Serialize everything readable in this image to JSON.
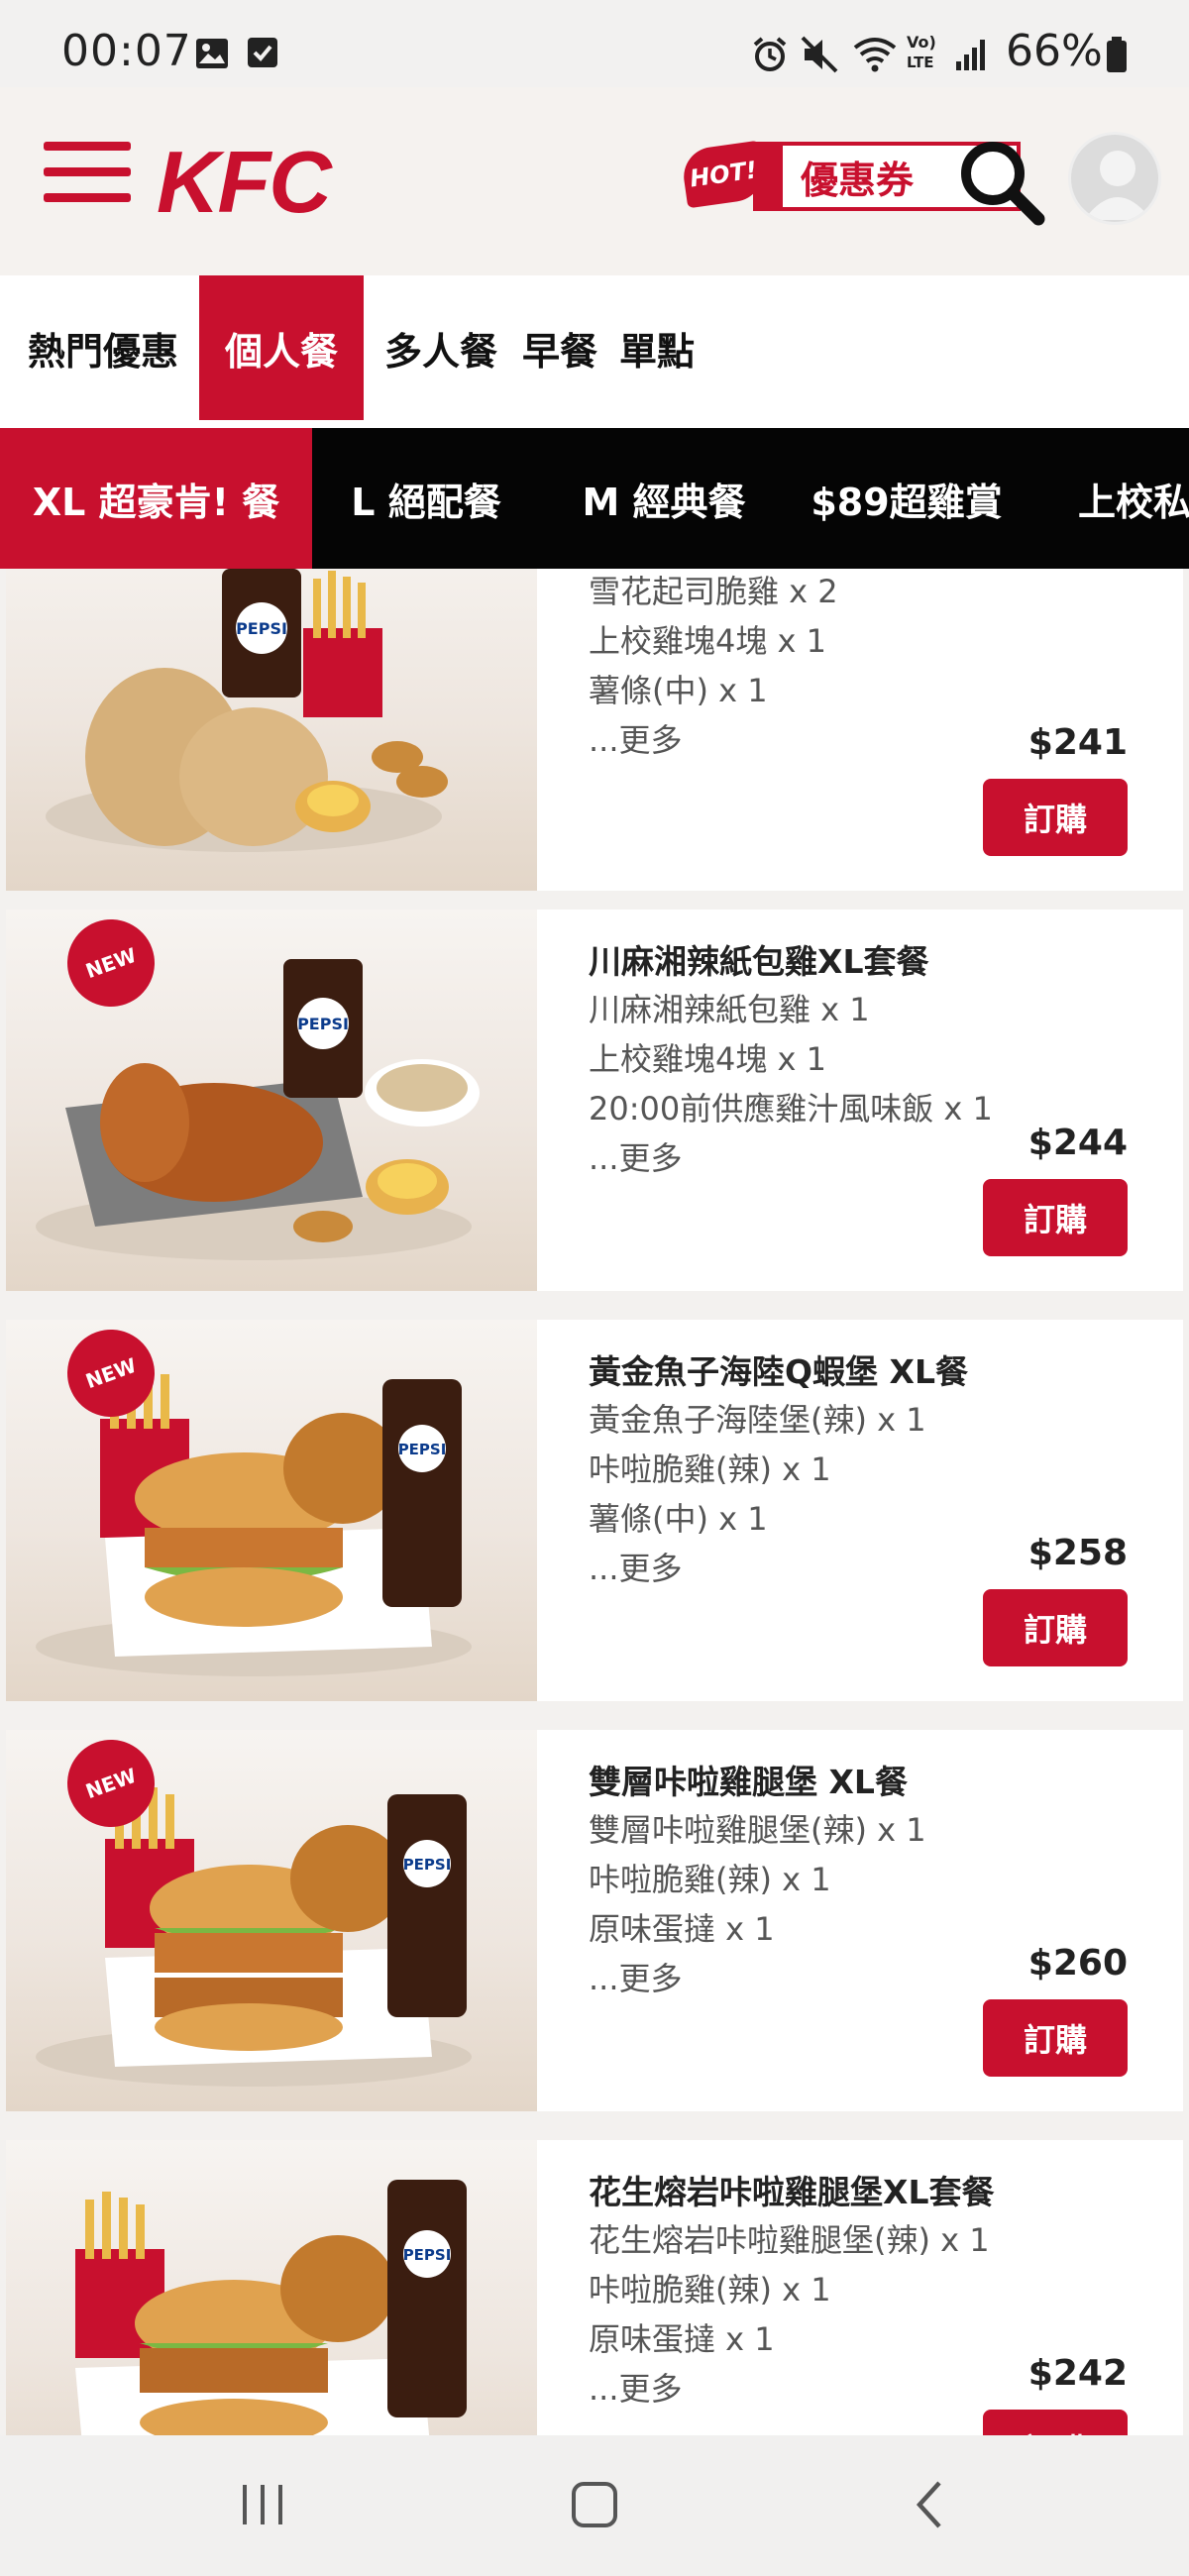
{
  "status_bar": {
    "time": "00:07",
    "battery": "66%",
    "icons": [
      "image-icon",
      "check-square-icon",
      "alarm-icon",
      "mute-icon",
      "wifi-icon",
      "volte-icon",
      "signal-icon",
      "battery-icon"
    ]
  },
  "header": {
    "logo": "KFC",
    "hot_badge": "HOT!",
    "coupon_label": "優惠券",
    "icons": [
      "menu-icon",
      "search-icon",
      "avatar-icon"
    ]
  },
  "category_tabs": [
    {
      "label": "熱門優惠",
      "active": false
    },
    {
      "label": "個人餐",
      "active": true
    },
    {
      "label": "多人餐",
      "active": false
    },
    {
      "label": "早餐",
      "active": false
    },
    {
      "label": "單點",
      "active": false
    }
  ],
  "sub_tabs": [
    {
      "label": "XL 超豪肯! 餐",
      "active": true
    },
    {
      "label": "L 絕配餐",
      "active": false
    },
    {
      "label": "M 經典餐",
      "active": false
    },
    {
      "label": "$89超雞賞",
      "active": false
    },
    {
      "label": "上校私",
      "active": false
    }
  ],
  "products": [
    {
      "title": "",
      "lines": [
        "雪花起司脆雞 x 2",
        "上校雞塊4塊 x 1",
        "薯條(中) x 1",
        "...更多"
      ],
      "price": "$241",
      "order_label": "訂購",
      "badge": "",
      "drink_label": "PEPSI"
    },
    {
      "title": "川麻湘辣紙包雞XL套餐",
      "lines": [
        "川麻湘辣紙包雞 x 1",
        "上校雞塊4塊 x 1",
        "20:00前供應雞汁風味飯 x 1",
        "...更多"
      ],
      "price": "$244",
      "order_label": "訂購",
      "badge": "NEW",
      "drink_label": "PEPSI"
    },
    {
      "title": "黃金魚子海陸Q蝦堡 XL餐",
      "lines": [
        "黃金魚子海陸堡(辣) x 1",
        "咔啦脆雞(辣) x 1",
        "薯條(中) x 1",
        "...更多"
      ],
      "price": "$258",
      "order_label": "訂購",
      "badge": "NEW",
      "drink_label": "PEPSI"
    },
    {
      "title": "雙層咔啦雞腿堡 XL餐",
      "lines": [
        "雙層咔啦雞腿堡(辣) x 1",
        "咔啦脆雞(辣) x 1",
        "原味蛋撻 x 1",
        "...更多"
      ],
      "price": "$260",
      "order_label": "訂購",
      "badge": "NEW",
      "drink_label": "PEPSI"
    },
    {
      "title": "花生熔岩咔啦雞腿堡XL套餐",
      "lines": [
        "花生熔岩咔啦雞腿堡(辣) x 1",
        "咔啦脆雞(辣) x 1",
        "原味蛋撻 x 1",
        "...更多"
      ],
      "price": "$242",
      "order_label": "訂購",
      "badge": "",
      "drink_label": "PEPSI"
    }
  ],
  "nav_bar": {
    "icons": [
      "recent-apps-icon",
      "home-icon",
      "back-icon"
    ]
  },
  "colors": {
    "brand_red": "#c8102e",
    "subtab_bg": "#050505",
    "header_bg": "#f5f2ef"
  }
}
